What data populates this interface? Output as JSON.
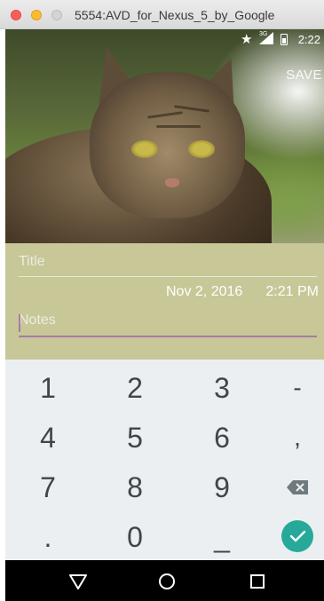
{
  "window": {
    "title": "5554:AVD_for_Nexus_5_by_Google"
  },
  "status_bar": {
    "time": "2:22",
    "network_label": "3G",
    "icons": [
      "star-icon",
      "signal-icon",
      "battery-icon"
    ]
  },
  "photo": {
    "subject": "cat-photo",
    "action_label": "SAVE"
  },
  "form": {
    "title_placeholder": "Title",
    "title_value": "",
    "date": "Nov 2, 2016",
    "time": "2:21 PM",
    "notes_placeholder": "Notes",
    "notes_value": "",
    "background_color": "#c7c798",
    "accent_color": "#a77aa8"
  },
  "keypad": {
    "rows": [
      [
        "1",
        "2",
        "3",
        "-"
      ],
      [
        "4",
        "5",
        "6",
        ","
      ],
      [
        "7",
        "8",
        "9",
        "backspace-icon"
      ],
      [
        ".",
        "0",
        "_",
        "done-check-icon"
      ]
    ],
    "done_color": "#27a99a"
  },
  "nav_bar": {
    "buttons": [
      "back-icon",
      "home-icon",
      "recents-icon"
    ]
  }
}
